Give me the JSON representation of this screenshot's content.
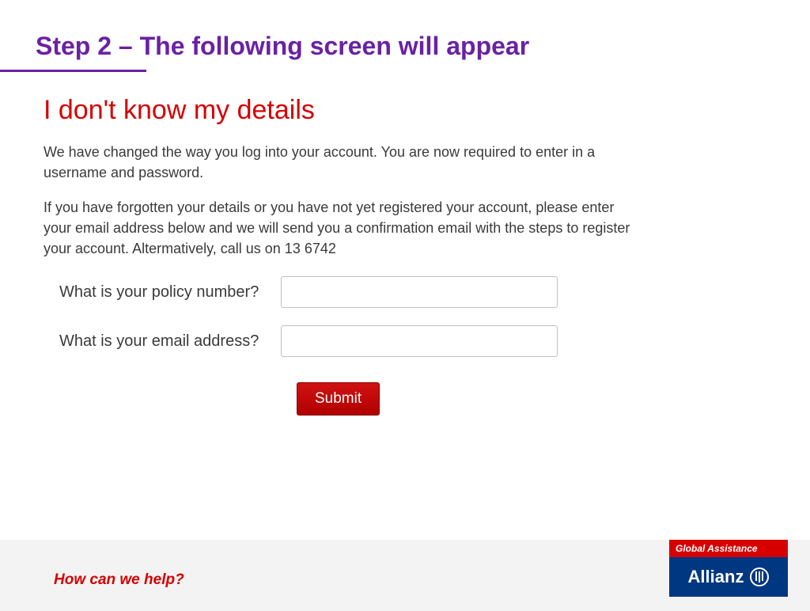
{
  "header": {
    "step_title": "Step 2 – The following screen will appear"
  },
  "content": {
    "subhead": "I don't know my details",
    "para1": "We have changed the way you log into your account. You are now required to enter in a username and password.",
    "para2": "If you have forgotten your details or you have not yet registered your account, please enter your email address below and we will send you a confirmation email with the steps to register your account. Altermatively, call us on 13 6742"
  },
  "form": {
    "policy_label": "What is your policy number?",
    "email_label": "What is your email address?",
    "policy_value": "",
    "email_value": "",
    "submit_label": "Submit"
  },
  "footer": {
    "tagline": "How can we help?",
    "brand_top": "Global Assistance",
    "brand_main": "Allianz"
  }
}
